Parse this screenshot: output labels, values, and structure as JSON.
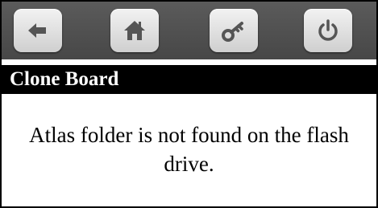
{
  "toolbar": {
    "buttons": [
      {
        "icon": "back-arrow-icon"
      },
      {
        "icon": "home-icon"
      },
      {
        "icon": "key-icon"
      },
      {
        "icon": "power-icon"
      }
    ],
    "icon_color": "#555555"
  },
  "screen": {
    "title": "Clone Board",
    "message": "Atlas folder is not found on the flash drive."
  }
}
